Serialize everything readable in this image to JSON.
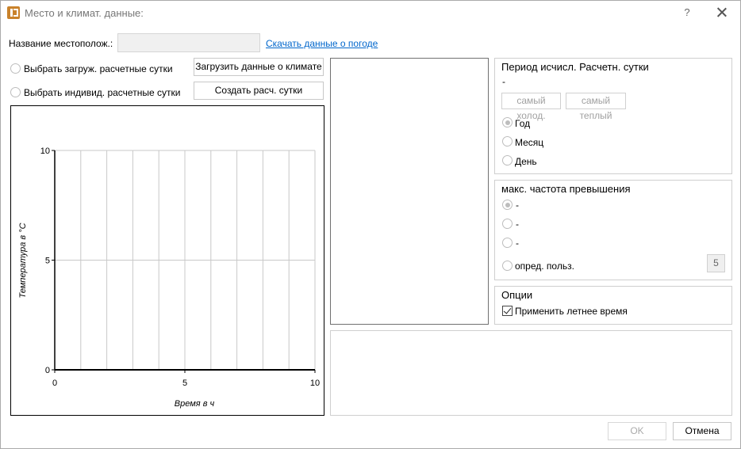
{
  "window": {
    "title": "Место и климат. данные:",
    "help": "?"
  },
  "location": {
    "label": "Название местополож.:",
    "value": "",
    "download_link": "Скачать данные о погоде"
  },
  "day_selection": {
    "option_loaded": "Выбрать загруж. расчетные сутки",
    "option_individual": "Выбрать индивид. расчетные сутки",
    "btn_load_climate": "Загрузить данные о климате",
    "btn_create_day": "Создать расч. сутки"
  },
  "chart_data": {
    "type": "line",
    "series": [],
    "xlabel": "Время в ч",
    "ylabel": "Температура в °C",
    "xlim": [
      0,
      10
    ],
    "ylim": [
      0,
      10
    ],
    "x_ticks": [
      "0",
      "5",
      "10"
    ],
    "y_ticks": [
      "0",
      "5",
      "10"
    ],
    "grid": true
  },
  "period": {
    "title": "Период исчисл. Расчетн. сутки",
    "value": "-",
    "btn_coldest": "самый холод.",
    "btn_warmest": "самый теплый",
    "options": [
      "Год",
      "Месяц",
      "День"
    ],
    "selected": "Год"
  },
  "frequency": {
    "title": "макс. частота превышения",
    "options": [
      "-",
      "-",
      "-"
    ],
    "custom_label": "опред. польз.",
    "custom_value": "5"
  },
  "options": {
    "title": "Опции",
    "dst_label": "Применить летнее время",
    "dst_checked": true
  },
  "footer": {
    "ok": "OK",
    "cancel": "Отмена"
  }
}
